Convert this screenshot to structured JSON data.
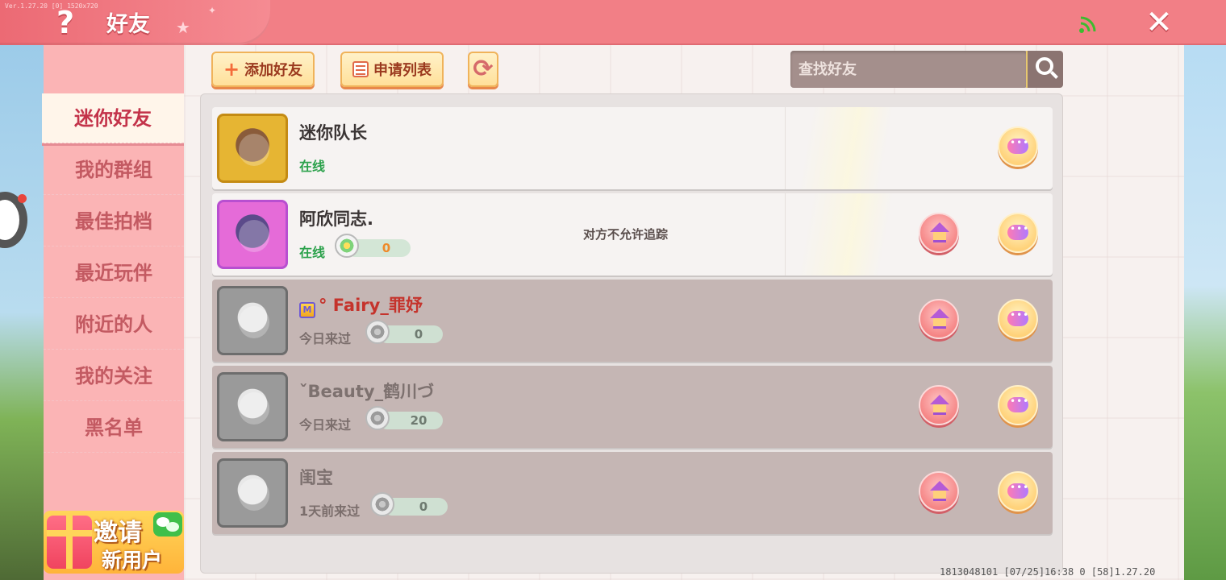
{
  "header": {
    "title": "好友",
    "help_icon": "?",
    "close_icon": "✕",
    "version_text": "Ver.1.27.20 [0] 1520x720"
  },
  "sidebar": {
    "items": [
      {
        "label": "迷你好友",
        "active": true
      },
      {
        "label": "我的群组",
        "active": false
      },
      {
        "label": "最佳拍档",
        "active": false
      },
      {
        "label": "最近玩伴",
        "active": false
      },
      {
        "label": "附近的人",
        "active": false
      },
      {
        "label": "我的关注",
        "active": false
      },
      {
        "label": "黑名单",
        "active": false
      }
    ],
    "invite": {
      "line1": "邀请",
      "line2": "新用户"
    }
  },
  "toolbar": {
    "add_friend_label": "添加好友",
    "request_list_label": "申请列表",
    "search_placeholder": "查找好友"
  },
  "friends": [
    {
      "name": "迷你队长",
      "status": "在线",
      "online": true,
      "avatar": "gold",
      "score": null,
      "privacy": null
    },
    {
      "name": "阿欣同志.",
      "status": "在线",
      "online": true,
      "avatar": "purple",
      "score": "0",
      "privacy": "对方不允许追踪"
    },
    {
      "name": "°  Fairy_罪妤",
      "status": "今日来过",
      "online": false,
      "avatar": "gray",
      "score": "0",
      "privacy": null,
      "name_color": "#c5332c"
    },
    {
      "name": "ˇBeauty_鹤川づ",
      "status": "今日来过",
      "online": false,
      "avatar": "gray",
      "score": "20",
      "privacy": null
    },
    {
      "name": "闺宝",
      "status": "1天前来过",
      "online": false,
      "avatar": "gray",
      "score": "0",
      "privacy": null
    }
  ],
  "footer": {
    "text": "1813048101    [07/25]16:38 0  [58]1.27.20"
  },
  "colors": {
    "header": "#f27f86",
    "sidebar": "#fbb4b5",
    "online_green": "#2ba14b",
    "accent_red": "#c3334a"
  }
}
